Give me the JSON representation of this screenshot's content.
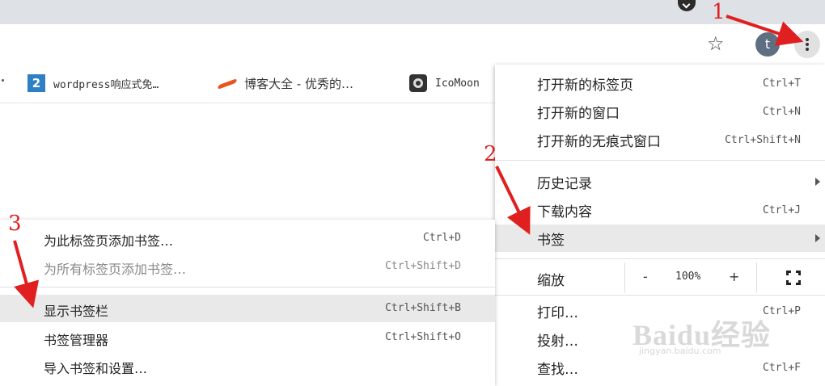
{
  "toolbar": {
    "profile_initial": "t"
  },
  "bookmarks_bar": [
    {
      "icon": "wordpress-2-icon",
      "label": "wordpress响应式免…",
      "mono": true
    },
    {
      "icon": "blog-wave-icon",
      "label": "博客大全 - 优秀的…",
      "mono": false
    },
    {
      "icon": "icomoon-icon",
      "label": "IcoMoon",
      "mono": true
    }
  ],
  "main_menu": {
    "items": [
      {
        "label": "打开新的标签页",
        "shortcut": "Ctrl+T"
      },
      {
        "label": "打开新的窗口",
        "shortcut": "Ctrl+N"
      },
      {
        "label": "打开新的无痕式窗口",
        "shortcut": "Ctrl+Shift+N"
      },
      {
        "label": "历史记录",
        "shortcut": ""
      },
      {
        "label": "下载内容",
        "shortcut": "Ctrl+J"
      },
      {
        "label": "书签",
        "shortcut": ""
      }
    ],
    "zoom": {
      "label": "缩放",
      "minus": "-",
      "value": "100%",
      "plus": "+"
    },
    "bottom_items": [
      {
        "label": "打印…",
        "shortcut": "Ctrl+P"
      },
      {
        "label": "投射…",
        "shortcut": ""
      },
      {
        "label": "查找…",
        "shortcut": "Ctrl+F"
      }
    ]
  },
  "bookmarks_submenu": {
    "items": [
      {
        "label": "为此标签页添加书签…",
        "shortcut": "Ctrl+D"
      },
      {
        "label": "为所有标签页添加书签…",
        "shortcut": "Ctrl+Shift+D"
      },
      {
        "label": "显示书签栏",
        "shortcut": "Ctrl+Shift+B"
      },
      {
        "label": "书签管理器",
        "shortcut": "Ctrl+Shift+O"
      },
      {
        "label": "导入书签和设置…",
        "shortcut": ""
      }
    ]
  },
  "annotations": {
    "step1": "1",
    "step2": "2",
    "step3": "3"
  },
  "watermark": {
    "text": "Baidu经验",
    "sub": "jingyan.baidu.com"
  }
}
